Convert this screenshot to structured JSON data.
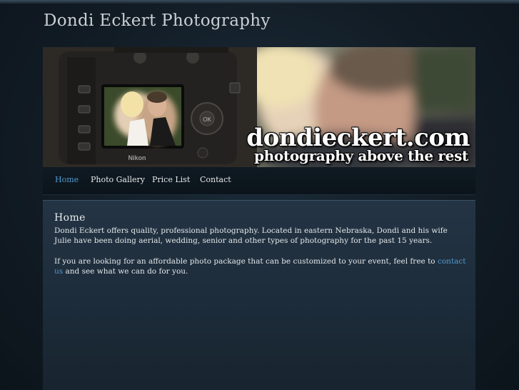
{
  "site": {
    "title": "Dondi Eckert Photography"
  },
  "banner": {
    "domain": "dondieckert.com",
    "tagline": "photography above the rest",
    "camera_brand": "Nikon",
    "camera_dial_label": "OK"
  },
  "nav": {
    "items": [
      {
        "label": "Home",
        "active": true
      },
      {
        "label": "Photo Gallery",
        "active": false
      },
      {
        "label": "Price List",
        "active": false
      },
      {
        "label": "Contact",
        "active": false
      }
    ]
  },
  "content": {
    "heading": "Home",
    "paragraph1": "Dondi Eckert offers quality, professional photography. Located in eastern Nebraska, Dondi and his wife Julie have been doing aerial, wedding, senior and other types of photography for the past 15 years.",
    "paragraph2_before": "If you are looking for an affordable photo package that can be customized to your event, feel free to ",
    "paragraph2_link": "contact us",
    "paragraph2_after": " and see what we can do for you."
  },
  "colors": {
    "link": "#4f9bd3",
    "background": "#121c25",
    "content_panel": "#243444"
  }
}
